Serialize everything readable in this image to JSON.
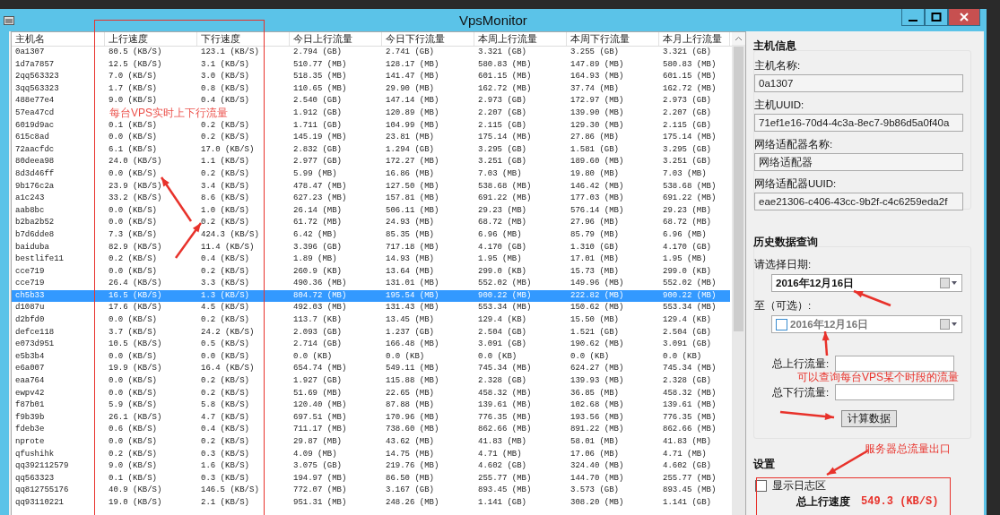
{
  "window": {
    "title": "VpsMonitor"
  },
  "table": {
    "columns": [
      "主机名",
      "上行速度",
      "下行速度",
      "今日上行流量",
      "今日下行流量",
      "本周上行流量",
      "本周下行流量",
      "本月上行流量"
    ],
    "rows": [
      {
        "selected": false,
        "cells": [
          "0a1307",
          "80.5 (KB/S)",
          "123.1 (KB/S)",
          "2.794 (GB)",
          "2.741 (GB)",
          "3.321 (GB)",
          "3.255 (GB)",
          "3.321 (GB)"
        ]
      },
      {
        "selected": false,
        "cells": [
          "1d7a7857",
          "12.5 (KB/S)",
          "3.1 (KB/S)",
          "510.77 (MB)",
          "128.17 (MB)",
          "580.83 (MB)",
          "147.89 (MB)",
          "580.83 (MB)"
        ]
      },
      {
        "selected": false,
        "cells": [
          "2qq563323",
          "7.0 (KB/S)",
          "3.0 (KB/S)",
          "518.35 (MB)",
          "141.47 (MB)",
          "601.15 (MB)",
          "164.93 (MB)",
          "601.15 (MB)"
        ]
      },
      {
        "selected": false,
        "cells": [
          "3qq563323",
          "1.7 (KB/S)",
          "0.8 (KB/S)",
          "110.65 (MB)",
          "29.90 (MB)",
          "162.72 (MB)",
          "37.74 (MB)",
          "162.72 (MB)"
        ]
      },
      {
        "selected": false,
        "cells": [
          "488e77e4",
          "9.0 (KB/S)",
          "0.4 (KB/S)",
          "2.540 (GB)",
          "147.14 (MB)",
          "2.973 (GB)",
          "172.97 (MB)",
          "2.973 (GB)"
        ]
      },
      {
        "selected": false,
        "cells": [
          "57ea47cd",
          null,
          null,
          "1.912 (GB)",
          "120.89 (MB)",
          "2.207 (GB)",
          "139.90 (MB)",
          "2.207 (GB)"
        ]
      },
      {
        "selected": false,
        "cells": [
          "6019d9ac",
          "0.1 (KB/S)",
          "0.2 (KB/S)",
          "1.711 (GB)",
          "104.99 (MB)",
          "2.115 (GB)",
          "129.30 (MB)",
          "2.115 (GB)"
        ]
      },
      {
        "selected": false,
        "cells": [
          "615c8ad",
          "0.0 (KB/S)",
          "0.2 (KB/S)",
          "145.19 (MB)",
          "23.81 (MB)",
          "175.14 (MB)",
          "27.86 (MB)",
          "175.14 (MB)"
        ]
      },
      {
        "selected": false,
        "cells": [
          "72aacfdc",
          "6.1 (KB/S)",
          "17.0 (KB/S)",
          "2.832 (GB)",
          "1.294 (GB)",
          "3.295 (GB)",
          "1.581 (GB)",
          "3.295 (GB)"
        ]
      },
      {
        "selected": false,
        "cells": [
          "80deea98",
          "24.0 (KB/S)",
          "1.1 (KB/S)",
          "2.977 (GB)",
          "172.27 (MB)",
          "3.251 (GB)",
          "189.60 (MB)",
          "3.251 (GB)"
        ]
      },
      {
        "selected": false,
        "cells": [
          "8d3d46ff",
          "0.0 (KB/S)",
          "0.2 (KB/S)",
          "5.99 (MB)",
          "16.86 (MB)",
          "7.03 (MB)",
          "19.80 (MB)",
          "7.03 (MB)"
        ]
      },
      {
        "selected": false,
        "cells": [
          "9b176c2a",
          "23.9 (KB/S)",
          "3.4 (KB/S)",
          "478.47 (MB)",
          "127.50 (MB)",
          "538.68 (MB)",
          "146.42 (MB)",
          "538.68 (MB)"
        ]
      },
      {
        "selected": false,
        "cells": [
          "a1c243",
          "33.2 (KB/S)",
          "8.6 (KB/S)",
          "627.23 (MB)",
          "157.81 (MB)",
          "691.22 (MB)",
          "177.03 (MB)",
          "691.22 (MB)"
        ]
      },
      {
        "selected": false,
        "cells": [
          "aab8bc",
          "0.0 (KB/S)",
          "1.0 (KB/S)",
          "26.14 (MB)",
          "506.11 (MB)",
          "29.23 (MB)",
          "576.14 (MB)",
          "29.23 (MB)"
        ]
      },
      {
        "selected": false,
        "cells": [
          "b2ba2b52",
          "0.0 (KB/S)",
          "0.2 (KB/S)",
          "61.72 (MB)",
          "24.93 (MB)",
          "68.72 (MB)",
          "27.96 (MB)",
          "68.72 (MB)"
        ]
      },
      {
        "selected": false,
        "cells": [
          "b7d6dde8",
          "7.3 (KB/S)",
          "424.3 (KB/S)",
          "6.42 (MB)",
          "85.35 (MB)",
          "6.96 (MB)",
          "85.79 (MB)",
          "6.96 (MB)"
        ]
      },
      {
        "selected": false,
        "cells": [
          "baiduba",
          "82.9 (KB/S)",
          "11.4 (KB/S)",
          "3.396 (GB)",
          "717.18 (MB)",
          "4.170 (GB)",
          "1.310 (GB)",
          "4.170 (GB)"
        ]
      },
      {
        "selected": false,
        "cells": [
          "bestlife11",
          "0.2 (KB/S)",
          "0.4 (KB/S)",
          "1.89 (MB)",
          "14.93 (MB)",
          "1.95 (MB)",
          "17.01 (MB)",
          "1.95 (MB)"
        ]
      },
      {
        "selected": false,
        "cells": [
          "cce719",
          "0.0 (KB/S)",
          "0.2 (KB/S)",
          "260.9 (KB)",
          "13.64 (MB)",
          "299.0 (KB)",
          "15.73 (MB)",
          "299.0 (KB)"
        ]
      },
      {
        "selected": false,
        "cells": [
          "cce719",
          "26.4 (KB/S)",
          "3.3 (KB/S)",
          "490.36 (MB)",
          "131.01 (MB)",
          "552.02 (MB)",
          "149.96 (MB)",
          "552.02 (MB)"
        ]
      },
      {
        "selected": true,
        "cells": [
          "ch5b33",
          "16.5 (KB/S)",
          "1.3 (KB/S)",
          "804.72 (MB)",
          "195.54 (MB)",
          "900.22 (MB)",
          "222.82 (MB)",
          "900.22 (MB)"
        ]
      },
      {
        "selected": false,
        "cells": [
          "d1087u",
          "17.6 (KB/S)",
          "4.5 (KB/S)",
          "492.03 (MB)",
          "131.43 (MB)",
          "553.34 (MB)",
          "150.62 (MB)",
          "553.34 (MB)"
        ]
      },
      {
        "selected": false,
        "cells": [
          "d2bfd0",
          "0.0 (KB/S)",
          "0.2 (KB/S)",
          "113.7 (KB)",
          "13.45 (MB)",
          "129.4 (KB)",
          "15.50 (MB)",
          "129.4 (KB)"
        ]
      },
      {
        "selected": false,
        "cells": [
          "defce118",
          "3.7 (KB/S)",
          "24.2 (KB/S)",
          "2.093 (GB)",
          "1.237 (GB)",
          "2.504 (GB)",
          "1.521 (GB)",
          "2.504 (GB)"
        ]
      },
      {
        "selected": false,
        "cells": [
          "e073d951",
          "10.5 (KB/S)",
          "0.5 (KB/S)",
          "2.714 (GB)",
          "166.48 (MB)",
          "3.091 (GB)",
          "190.62 (MB)",
          "3.091 (GB)"
        ]
      },
      {
        "selected": false,
        "cells": [
          "e5b3b4",
          "0.0 (KB/S)",
          "0.0 (KB/S)",
          "0.0 (KB)",
          "0.0 (KB)",
          "0.0 (KB)",
          "0.0 (KB)",
          "0.0 (KB)"
        ]
      },
      {
        "selected": false,
        "cells": [
          "e6a007",
          "19.9 (KB/S)",
          "16.4 (KB/S)",
          "654.74 (MB)",
          "549.11 (MB)",
          "745.34 (MB)",
          "624.27 (MB)",
          "745.34 (MB)"
        ]
      },
      {
        "selected": false,
        "cells": [
          "eaa764",
          "0.0 (KB/S)",
          "0.2 (KB/S)",
          "1.927 (GB)",
          "115.88 (MB)",
          "2.328 (GB)",
          "139.93 (MB)",
          "2.328 (GB)"
        ]
      },
      {
        "selected": false,
        "cells": [
          "ewpv42",
          "0.0 (KB/S)",
          "0.2 (KB/S)",
          "51.69 (MB)",
          "22.65 (MB)",
          "458.32 (MB)",
          "36.85 (MB)",
          "458.32 (MB)"
        ]
      },
      {
        "selected": false,
        "cells": [
          "f87b01",
          "5.9 (KB/S)",
          "5.8 (KB/S)",
          "120.40 (MB)",
          "87.88 (MB)",
          "139.61 (MB)",
          "102.68 (MB)",
          "139.61 (MB)"
        ]
      },
      {
        "selected": false,
        "cells": [
          "f9b39b",
          "26.1 (KB/S)",
          "4.7 (KB/S)",
          "697.51 (MB)",
          "170.96 (MB)",
          "776.35 (MB)",
          "193.56 (MB)",
          "776.35 (MB)"
        ]
      },
      {
        "selected": false,
        "cells": [
          "fdeb3e",
          "0.6 (KB/S)",
          "0.4 (KB/S)",
          "711.17 (MB)",
          "738.60 (MB)",
          "862.66 (MB)",
          "891.22 (MB)",
          "862.66 (MB)"
        ]
      },
      {
        "selected": false,
        "cells": [
          "nprote",
          "0.0 (KB/S)",
          "0.2 (KB/S)",
          "29.87 (MB)",
          "43.62 (MB)",
          "41.83 (MB)",
          "58.01 (MB)",
          "41.83 (MB)"
        ]
      },
      {
        "selected": false,
        "cells": [
          "qfushihk",
          "0.2 (KB/S)",
          "0.3 (KB/S)",
          "4.09 (MB)",
          "14.75 (MB)",
          "4.71 (MB)",
          "17.06 (MB)",
          "4.71 (MB)"
        ]
      },
      {
        "selected": false,
        "cells": [
          "qq392112579",
          "9.0 (KB/S)",
          "1.6 (KB/S)",
          "3.075 (GB)",
          "219.76 (MB)",
          "4.602 (GB)",
          "324.40 (MB)",
          "4.602 (GB)"
        ]
      },
      {
        "selected": false,
        "cells": [
          "qq563323",
          "0.1 (KB/S)",
          "0.3 (KB/S)",
          "194.97 (MB)",
          "86.50 (MB)",
          "255.77 (MB)",
          "144.70 (MB)",
          "255.77 (MB)"
        ]
      },
      {
        "selected": false,
        "cells": [
          "qq812755176",
          "40.9 (KB/S)",
          "146.5 (KB/S)",
          "772.07 (MB)",
          "3.167 (GB)",
          "893.45 (MB)",
          "3.573 (GB)",
          "893.45 (MB)"
        ]
      },
      {
        "selected": false,
        "cells": [
          "qq93110221",
          "19.0 (KB/S)",
          "2.1 (KB/S)",
          "951.31 (MB)",
          "248.26 (MB)",
          "1.141 (GB)",
          "308.20 (MB)",
          "1.141 (GB)"
        ]
      }
    ]
  },
  "host_info": {
    "title": "主机信息",
    "fields": [
      {
        "label": "主机名称:",
        "value": "0a1307"
      },
      {
        "label": "主机UUID:",
        "value": "71ef1e16-70d4-4c3a-8ec7-9b86d5a0f40a"
      },
      {
        "label": "网络适配器名称:",
        "value": "网络适配器"
      },
      {
        "label": "网络适配器UUID:",
        "value": "eae21306-c406-43cc-9b2f-c4c6259eda2f"
      }
    ]
  },
  "history": {
    "title": "历史数据查询",
    "start_label": "请选择日期:",
    "start_date": "2016年12月16日",
    "end_label": "至（可选）:",
    "end_date": "2016年12月16日",
    "end_checked": false,
    "up_label": "总上行流量:",
    "down_label": "总下行流量:",
    "button": "计算数据"
  },
  "settings": {
    "title": "设置",
    "log_checkbox": {
      "label": "显示日志区",
      "checked": false
    },
    "total_up_label": "总上行速度",
    "total_up_value": "549.3 (KB/S)"
  },
  "annotations": [
    {
      "kind": "speed",
      "text": "每台VPS实时上下行流量"
    },
    {
      "kind": "query",
      "text": "可以查询每台VPS某个时段的流量"
    },
    {
      "kind": "total",
      "text": "服务器总流量出口"
    }
  ]
}
